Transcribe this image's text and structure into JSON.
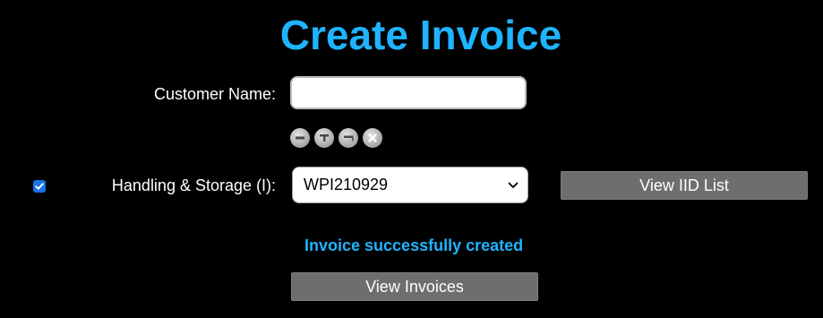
{
  "page": {
    "title": "Create Invoice"
  },
  "form": {
    "customer_name_label": "Customer Name:",
    "customer_name_value": "",
    "customer_name_placeholder": "",
    "icons": [
      "minus-circle-icon",
      "plus-bar-icon",
      "minus-bar-icon",
      "close-circle-icon"
    ],
    "handling_checkbox_checked": true,
    "handling_label": "Handling & Storage (I):",
    "handling_selected": "WPI210929",
    "view_iid_label": "View IID List"
  },
  "status": {
    "message": "Invoice successfully created"
  },
  "actions": {
    "view_invoices_label": "View Invoices"
  },
  "colors": {
    "accent": "#1eb4ff",
    "background": "#000000",
    "button": "#6e6e6e",
    "checkbox": "#1a73e8"
  }
}
